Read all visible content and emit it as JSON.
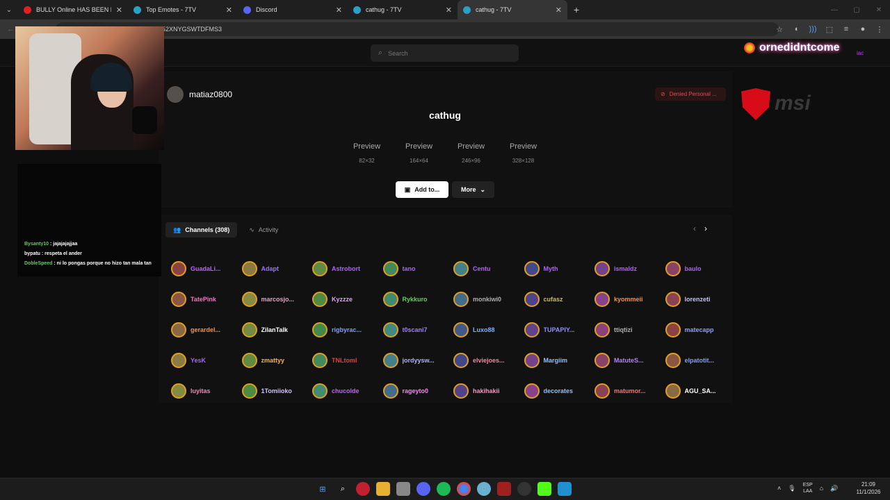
{
  "browser": {
    "tabs": [
      {
        "title": "BULLY Online HAS BEEN RELEA",
        "favicon_color": "#e02020",
        "active": false
      },
      {
        "title": "Top Emotes - 7TV",
        "favicon_color": "#29a0c8",
        "active": false
      },
      {
        "title": "Discord",
        "favicon_color": "#5865f2",
        "active": false
      },
      {
        "title": "cathug - 7TV",
        "favicon_color": "#29a0c8",
        "active": false
      },
      {
        "title": "cathug - 7TV",
        "favicon_color": "#29a0c8",
        "active": true
      }
    ],
    "new_tab": "+",
    "close": "✕",
    "address": "52XNYGSWTDFMS3"
  },
  "site": {
    "search_placeholder": "Search",
    "uploader": "matiaz0800",
    "denied_label": "Denied Personal ...",
    "emote_name": "cathug",
    "previews": [
      {
        "alt": "Preview",
        "size": "82×32"
      },
      {
        "alt": "Preview",
        "size": "164×64"
      },
      {
        "alt": "Preview",
        "size": "246×96"
      },
      {
        "alt": "Preview",
        "size": "328×128"
      }
    ],
    "add_label": "Add to...",
    "more_label": "More",
    "channels_tab": "Channels (308)",
    "activity_tab": "Activity",
    "channels": [
      {
        "name": "GuadaLi...",
        "color": "#c060ff"
      },
      {
        "name": "Adapt",
        "color": "#a070ff"
      },
      {
        "name": "Astrobort",
        "color": "#b060ff"
      },
      {
        "name": "tano",
        "color": "#b060ff"
      },
      {
        "name": "Centu",
        "color": "#b060ff"
      },
      {
        "name": "Myth",
        "color": "#b060ff"
      },
      {
        "name": "ismaldz",
        "color": "#b060ff"
      },
      {
        "name": "baulo",
        "color": "#b060ff"
      },
      {
        "name": "TatePink",
        "color": "#ff70c0"
      },
      {
        "name": "marcosjo...",
        "color": "#e8a0c0"
      },
      {
        "name": "Kyzzze",
        "color": "#e0a0ff"
      },
      {
        "name": "Rykkuro",
        "color": "#60d060"
      },
      {
        "name": "monkiwi0",
        "color": "#b0b0b0"
      },
      {
        "name": "cufasz",
        "color": "#d0c040"
      },
      {
        "name": "kyommeii",
        "color": "#ff9040"
      },
      {
        "name": "lorenzeti",
        "color": "#c0c0ff"
      },
      {
        "name": "gerardel...",
        "color": "#ff9040"
      },
      {
        "name": "ZilanTalk",
        "color": "#ffffff"
      },
      {
        "name": "rigbyrac...",
        "color": "#80a0ff"
      },
      {
        "name": "t0scani7",
        "color": "#a080ff"
      },
      {
        "name": "Luxo88",
        "color": "#80b0ff"
      },
      {
        "name": "TUPAPIY...",
        "color": "#9090ff"
      },
      {
        "name": "ttiqtizi",
        "color": "#b0b0b0"
      },
      {
        "name": "matecapp",
        "color": "#90a0ff"
      },
      {
        "name": "YesK",
        "color": "#b060ff"
      },
      {
        "name": "zmattyy",
        "color": "#ffb040"
      },
      {
        "name": "TNLtoml",
        "color": "#e04040"
      },
      {
        "name": "jordyysw...",
        "color": "#b0b0ff"
      },
      {
        "name": "elviejoes...",
        "color": "#ff80a0"
      },
      {
        "name": "Margiim",
        "color": "#90c0ff"
      },
      {
        "name": "MatuteS...",
        "color": "#b080ff"
      },
      {
        "name": "elpatotit...",
        "color": "#80a0ff"
      },
      {
        "name": "luyitas",
        "color": "#ff80c0"
      },
      {
        "name": "1Tomiioko",
        "color": "#d0c0ff"
      },
      {
        "name": "chucolde",
        "color": "#c060ff"
      },
      {
        "name": "rageyto0",
        "color": "#ff80ff"
      },
      {
        "name": "hakihakii",
        "color": "#ff90c0"
      },
      {
        "name": "decorates",
        "color": "#90c0ff"
      },
      {
        "name": "matumor...",
        "color": "#ff7070"
      },
      {
        "name": "AGU_SA...",
        "color": "#ffffff"
      }
    ]
  },
  "stream_overlay": {
    "chat": [
      {
        "user": "Bysanty10",
        "message": ": jajajajajjaa"
      },
      {
        "user": "bypatu",
        "message": ": respeta el ander"
      },
      {
        "user": "DobleSpeed",
        "message": ": ni lo pongas porque no hizo tan mala tan"
      }
    ],
    "streamer_name": "ornedidntcome",
    "corner_text": "iac",
    "sponsor": "msi"
  },
  "taskbar": {
    "lang_top": "ESP",
    "lang_bottom": "LAA",
    "time": "21:09",
    "date": "11/1/2026"
  }
}
